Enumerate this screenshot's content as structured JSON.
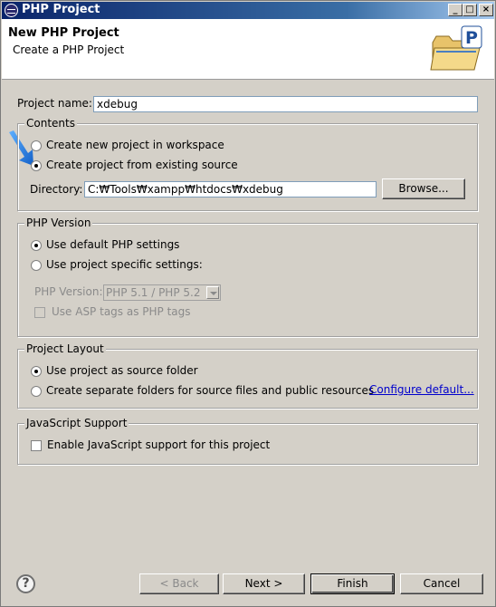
{
  "window": {
    "title": "PHP Project",
    "controls": [
      "_",
      "□",
      "×"
    ]
  },
  "header": {
    "title": "New PHP Project",
    "description": "Create a PHP Project"
  },
  "project_name": {
    "label": "Project name:",
    "value": "xdebug"
  },
  "contents": {
    "legend": "Contents",
    "option_new": "Create new project in workspace",
    "option_existing": "Create project from existing source",
    "selected": "existing",
    "directory_label": "Directory:",
    "directory_value": "C:₩Tools₩xampp₩htdocs₩xdebug",
    "browse_label": "Browse..."
  },
  "php_version": {
    "legend": "PHP Version",
    "option_default": "Use default PHP settings",
    "option_specific": "Use project specific settings:",
    "selected": "default",
    "version_label": "PHP Version:",
    "version_value": "PHP 5.1 / PHP 5.2",
    "asp_tags_label": "Use ASP tags as PHP tags"
  },
  "project_layout": {
    "legend": "Project Layout",
    "option_source": "Use project as source folder",
    "option_separate": "Create separate folders for source files and public resources",
    "selected": "source",
    "configure_link": "Configure default..."
  },
  "javascript": {
    "legend": "JavaScript Support",
    "enable_label": "Enable JavaScript support for this project",
    "enabled": false
  },
  "footer": {
    "help_label": "?",
    "back_label": "< Back",
    "next_label": "Next >",
    "finish_label": "Finish",
    "cancel_label": "Cancel"
  },
  "colors": {
    "title_bar": "#0a246a",
    "dialog_bg": "#d4d0c8",
    "link": "#0000cc",
    "annotation_arrow": "#1e7be0"
  }
}
